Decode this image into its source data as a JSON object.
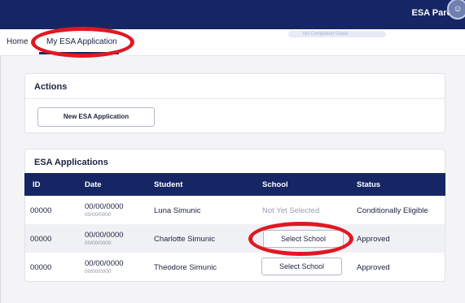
{
  "header": {
    "user_label": "ESA Parent",
    "avatar_icon": "user-avatar-icon"
  },
  "nav": {
    "home_label": "Home",
    "current_label": "My ESA Application",
    "faint_pill": "No Completed Goals"
  },
  "actions": {
    "title": "Actions",
    "new_button": "New ESA Application"
  },
  "applications": {
    "title": "ESA Applications",
    "columns": [
      "ID",
      "Date",
      "Student",
      "School",
      "Status"
    ],
    "rows": [
      {
        "id": "00000",
        "date": "00/00/0000",
        "date_sub": "00/00/0000",
        "student": "Luna Simunic",
        "school": "Not Yet Selected",
        "status": "Conditionally Eligible"
      },
      {
        "id": "00000",
        "date": "00/00/0000",
        "date_sub": "00/00/0000",
        "student": "Charlotte Simunic",
        "school": "Select School",
        "status": "Approved"
      },
      {
        "id": "00000",
        "date": "00/00/0000",
        "date_sub": "00/00/0000",
        "student": "Theodore Simunic",
        "school": "Select School",
        "status": "Approved"
      }
    ]
  },
  "colors": {
    "navy": "#162664",
    "annotation_red": "#e01822",
    "background": "#f4f4f6"
  }
}
